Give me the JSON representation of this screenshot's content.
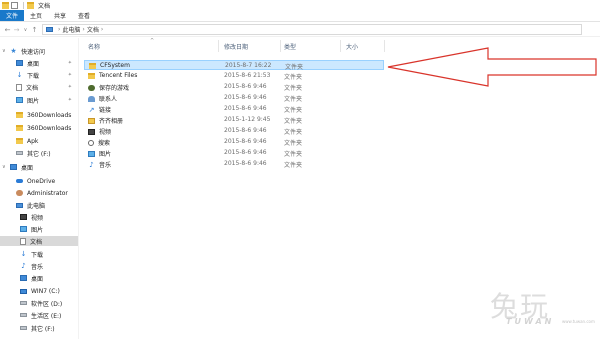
{
  "window": {
    "title": "文档"
  },
  "ribbon": {
    "tabs": [
      "文件",
      "主页",
      "共享",
      "查看"
    ]
  },
  "address": {
    "crumbs": [
      "此电脑",
      "文档"
    ]
  },
  "nav": {
    "items": [
      {
        "label": "快速访问",
        "icon": "star-icon"
      },
      {
        "label": "桌面",
        "icon": "desktop-icon",
        "pinned": true
      },
      {
        "label": "下载",
        "icon": "download-icon",
        "pinned": true
      },
      {
        "label": "文档",
        "icon": "document-icon",
        "pinned": true
      },
      {
        "label": "图片",
        "icon": "picture-icon",
        "pinned": true
      },
      {
        "label": "360Downloads",
        "icon": "folder-icon"
      },
      {
        "label": "360Downloads",
        "icon": "folder-icon"
      },
      {
        "label": "Apk",
        "icon": "folder-icon"
      },
      {
        "label": "其它 (F:)",
        "icon": "drive-icon"
      },
      {
        "label": "桌面",
        "icon": "desktop-icon"
      },
      {
        "label": "OneDrive",
        "icon": "cloud-icon"
      },
      {
        "label": "Administrator",
        "icon": "user-icon"
      },
      {
        "label": "此电脑",
        "icon": "computer-icon"
      },
      {
        "label": "视频",
        "icon": "video-icon"
      },
      {
        "label": "图片",
        "icon": "picture-icon"
      },
      {
        "label": "文档",
        "icon": "document-icon",
        "selected": true
      },
      {
        "label": "下载",
        "icon": "download-icon"
      },
      {
        "label": "音乐",
        "icon": "music-icon"
      },
      {
        "label": "桌面",
        "icon": "desktop-icon"
      },
      {
        "label": "WIN7 (C:)",
        "icon": "windows-drive-icon"
      },
      {
        "label": "软件区 (D:)",
        "icon": "drive-icon"
      },
      {
        "label": "生活区 (E:)",
        "icon": "drive-icon"
      },
      {
        "label": "其它 (F:)",
        "icon": "drive-icon"
      }
    ]
  },
  "columns": {
    "name": "名称",
    "date": "修改日期",
    "type": "类型",
    "size": "大小"
  },
  "files": [
    {
      "name": "CFSystem",
      "date": "2015-8-7 16:22",
      "type": "文件夹",
      "icon": "folder-icon",
      "selected": true
    },
    {
      "name": "Tencent Files",
      "date": "2015-8-6 21:53",
      "type": "文件夹",
      "icon": "folder-icon"
    },
    {
      "name": "保存的游戏",
      "date": "2015-8-6 9:46",
      "type": "文件夹",
      "icon": "saved-games-icon"
    },
    {
      "name": "联系人",
      "date": "2015-8-6 9:46",
      "type": "文件夹",
      "icon": "contacts-icon"
    },
    {
      "name": "链接",
      "date": "2015-8-6 9:46",
      "type": "文件夹",
      "icon": "links-icon"
    },
    {
      "name": "齐齐相册",
      "date": "2015-1-12 9:45",
      "type": "文件夹",
      "icon": "album-icon"
    },
    {
      "name": "视频",
      "date": "2015-8-6 9:46",
      "type": "文件夹",
      "icon": "video-icon"
    },
    {
      "name": "搜索",
      "date": "2015-8-6 9:46",
      "type": "文件夹",
      "icon": "search-icon"
    },
    {
      "name": "图片",
      "date": "2015-8-6 9:46",
      "type": "文件夹",
      "icon": "picture-icon"
    },
    {
      "name": "音乐",
      "date": "2015-8-6 9:46",
      "type": "文件夹",
      "icon": "music-icon"
    }
  ],
  "watermark": {
    "text": "兔玩",
    "sub": "TUWAN",
    "url": "www.tuwan.com"
  },
  "colors": {
    "accent": "#1979ca",
    "selection": "#cce8ff",
    "annotation": "#d9342b"
  }
}
